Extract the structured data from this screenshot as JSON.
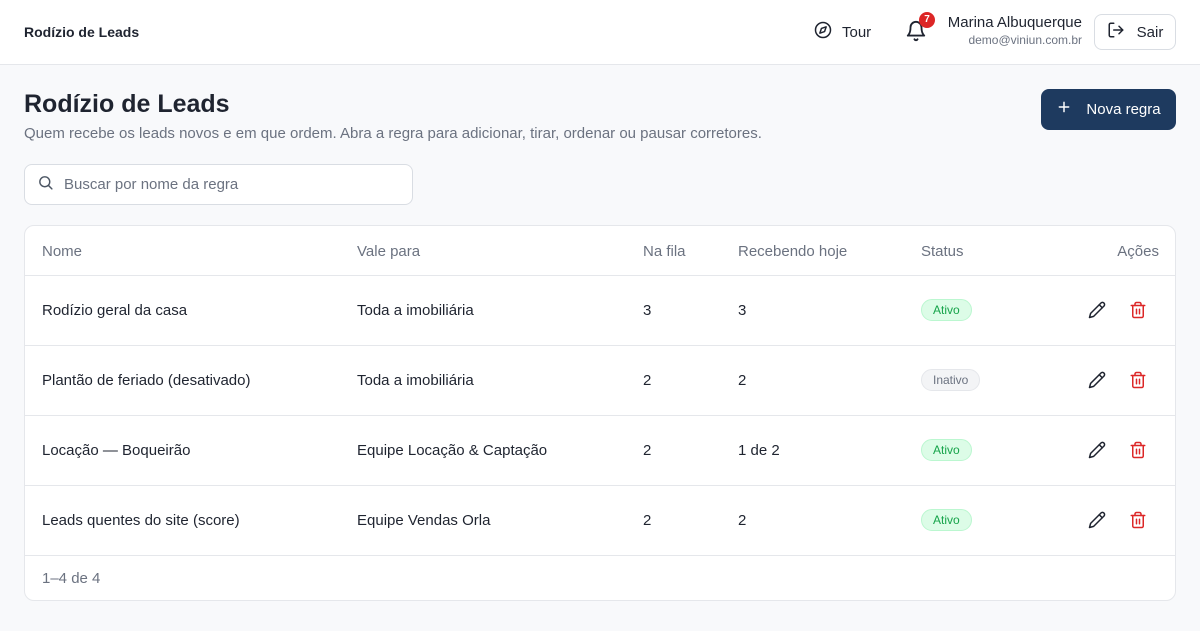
{
  "topbar": {
    "app_title": "Rodízio de Leads",
    "tour_label": "Tour",
    "notifications_count": "7",
    "user_name": "Marina Albuquerque",
    "user_email": "demo@viniun.com.br",
    "logout_label": "Sair"
  },
  "header": {
    "title": "Rodízio de Leads",
    "subtitle": "Quem recebe os leads novos e em que ordem. Abra a regra para adicionar, tirar, ordenar ou pausar corretores.",
    "new_rule_label": "Nova regra"
  },
  "search": {
    "placeholder": "Buscar por nome da regra",
    "value": ""
  },
  "table": {
    "columns": [
      "Nome",
      "Vale para",
      "Na fila",
      "Recebendo hoje",
      "Status",
      "Ações"
    ],
    "rows": [
      {
        "name": "Rodízio geral da casa",
        "scope": "Toda a imobiliária",
        "queue": "3",
        "today": "3",
        "status": "Ativo"
      },
      {
        "name": "Plantão de feriado (desativado)",
        "scope": "Toda a imobiliária",
        "queue": "2",
        "today": "2",
        "status": "Inativo"
      },
      {
        "name": "Locação — Boqueirão",
        "scope": "Equipe Locação & Captação",
        "queue": "2",
        "today": "1 de 2",
        "status": "Ativo"
      },
      {
        "name": "Leads quentes do site (score)",
        "scope": "Equipe Vendas Orla",
        "queue": "2",
        "today": "2",
        "status": "Ativo"
      }
    ],
    "pagination": "1–4 de 4"
  },
  "icons": {
    "tour": "compass-icon",
    "notifications": "bell-icon",
    "logout": "log-out-icon",
    "new_rule": "plus-icon",
    "search": "search-icon",
    "edit": "pencil-icon",
    "delete": "trash-icon"
  },
  "colors": {
    "primary": "#1e3a5f",
    "active_badge": "#16a34a",
    "delete": "#dc2626",
    "notification_badge": "#dc2626"
  }
}
